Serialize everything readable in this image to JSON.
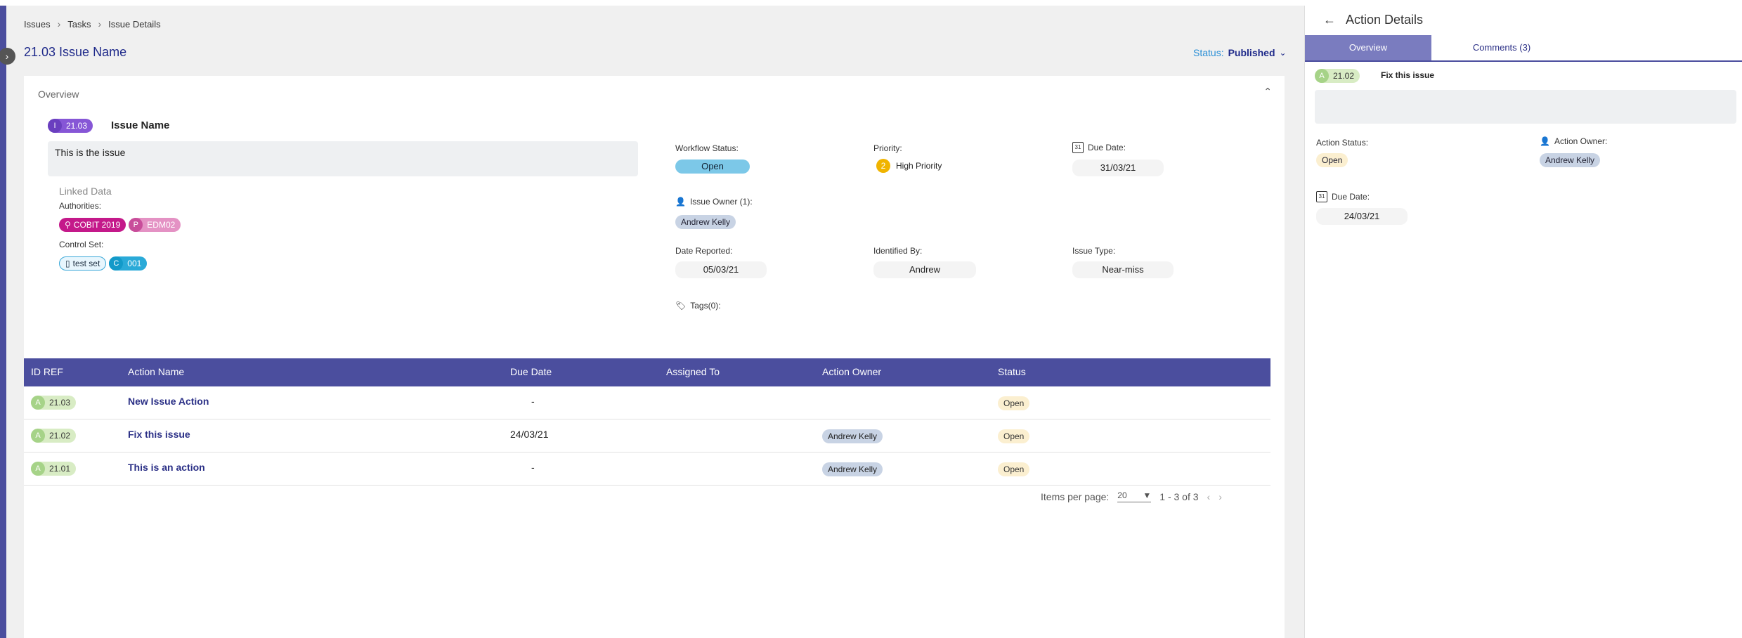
{
  "breadcrumbs": [
    "Issues",
    "Tasks",
    "Issue Details"
  ],
  "page_title": "21.03 Issue Name",
  "status": {
    "label": "Status:",
    "value": "Published"
  },
  "overview": {
    "heading": "Overview",
    "issue_prefix": "I",
    "issue_ref": "21.03",
    "issue_name": "Issue Name",
    "description": "This is the issue",
    "linked_data": "Linked Data",
    "authorities_label": "Authorities:",
    "authority_1": "COBIT 2019",
    "authority_2_prefix": "P",
    "authority_2": "EDM02",
    "control_set_label": "Control Set:",
    "control_set": "test set",
    "control_prefix": "C",
    "control": "001",
    "workflow_status_label": "Workflow Status:",
    "workflow_status": "Open",
    "priority_label": "Priority:",
    "priority_num": "2",
    "priority": "High Priority",
    "due_date_label": "Due Date:",
    "due_date": "31/03/21",
    "issue_owner_label": "Issue Owner (1):",
    "issue_owner": "Andrew Kelly",
    "date_reported_label": "Date Reported:",
    "date_reported": "05/03/21",
    "identified_by_label": "Identified By:",
    "identified_by": "Andrew",
    "issue_type_label": "Issue Type:",
    "issue_type": "Near-miss",
    "tags_label": "Tags(0):"
  },
  "table": {
    "headers": [
      "ID REF",
      "Action Name",
      "Due Date",
      "Assigned To",
      "Action Owner",
      "Status"
    ],
    "rows": [
      {
        "prefix": "A",
        "ref": "21.03",
        "name": "New Issue Action",
        "due": "-",
        "owner": "",
        "status": "Open"
      },
      {
        "prefix": "A",
        "ref": "21.02",
        "name": "Fix this issue",
        "due": "24/03/21",
        "owner": "Andrew Kelly",
        "status": "Open"
      },
      {
        "prefix": "A",
        "ref": "21.01",
        "name": "This is an action",
        "due": "-",
        "owner": "Andrew Kelly",
        "status": "Open"
      }
    ]
  },
  "pager": {
    "label": "Items per page:",
    "per_page": "20",
    "range": "1 - 3 of 3"
  },
  "side": {
    "title": "Action Details",
    "tab_overview": "Overview",
    "tab_comments": "Comments (3)",
    "prefix": "A",
    "ref": "21.02",
    "name": "Fix this issue",
    "action_status_label": "Action Status:",
    "action_status": "Open",
    "action_owner_label": "Action Owner:",
    "action_owner": "Andrew Kelly",
    "due_date_label": "Due Date:",
    "due_date": "24/03/21"
  }
}
